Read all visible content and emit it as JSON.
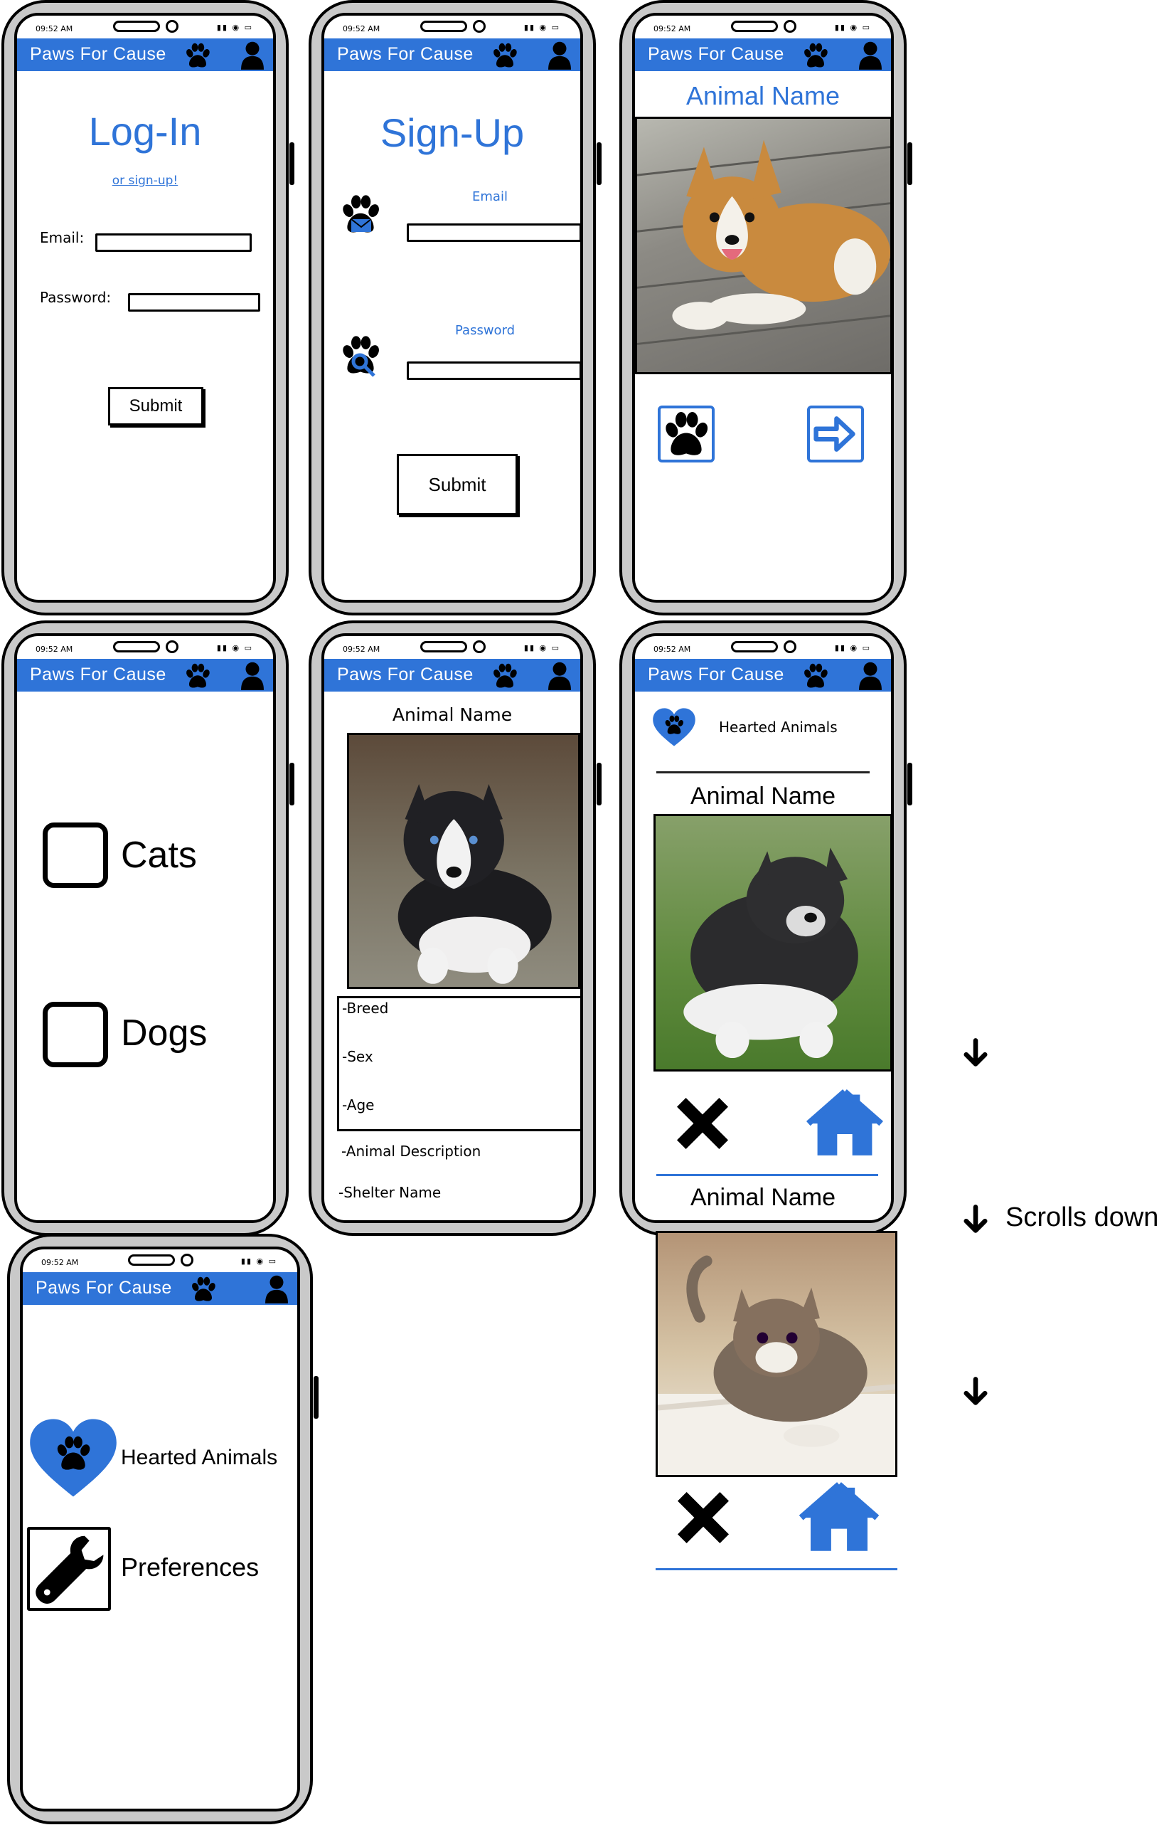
{
  "app": {
    "name": "Paws For Cause",
    "time": "09:52 AM",
    "brand_color": "#2f74d8"
  },
  "login": {
    "title": "Log-In",
    "signup_link": "or sign-up!",
    "email_label": "Email:",
    "password_label": "Password:",
    "submit": "Submit"
  },
  "signup": {
    "title": "Sign-Up",
    "email_label": "Email",
    "password_label": "Password",
    "submit": "Submit"
  },
  "swipe": {
    "animal_name": "Animal Name",
    "heart_icon": "paw-heart-icon",
    "next_icon": "arrow-right-icon"
  },
  "preferences": {
    "options": [
      "Cats",
      "Dogs"
    ]
  },
  "details": {
    "animal_name": "Animal Name",
    "fields": [
      "-Breed",
      "-Sex",
      "-Age",
      "-Animal Description",
      "-Shelter Name"
    ]
  },
  "hearted": {
    "header": "Hearted Animals",
    "cards": [
      {
        "animal_name": "Animal Name"
      },
      {
        "animal_name": "Animal Name"
      }
    ]
  },
  "menu": {
    "items": [
      "Hearted Animals",
      "Preferences"
    ]
  },
  "annotations": {
    "scroll_note": "Scrolls down"
  }
}
